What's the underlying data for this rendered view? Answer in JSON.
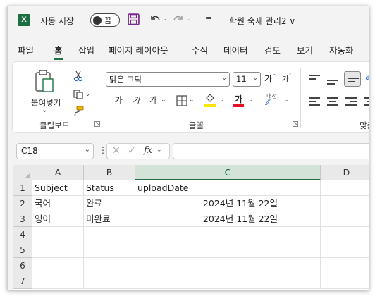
{
  "titlebar": {
    "app_icon": "excel-logo-icon",
    "app_icon_letter": "X",
    "autosave_label": "자동 저장",
    "autosave_state": "끔",
    "doc_title": "학원 숙제 관리2 ∨",
    "customize_glyph": "="
  },
  "tabs": [
    {
      "label": "파일"
    },
    {
      "label": "홈",
      "active": true
    },
    {
      "label": "삽입"
    },
    {
      "label": "페이지 레이아웃"
    },
    {
      "label": "수식"
    },
    {
      "label": "데이터"
    },
    {
      "label": "검토"
    },
    {
      "label": "보기"
    },
    {
      "label": "자동화"
    }
  ],
  "ribbon": {
    "clipboard": {
      "paste_label": "붙여넣기",
      "paste_dropdown": "⌄",
      "group_label": "클립보드"
    },
    "font": {
      "font_name": "맑은 고딕",
      "font_size": "11",
      "grow": "가",
      "shrink": "가",
      "bold": "가",
      "italic": "가",
      "underline": "가",
      "font_color": "가",
      "phonetic": "내천",
      "group_label": "글꼴"
    },
    "alignment": {
      "group_label": "맞춤"
    }
  },
  "formula_bar": {
    "name_box": "C18",
    "fx_label": "fx",
    "value": ""
  },
  "sheet": {
    "columns": [
      "A",
      "B",
      "C",
      "D"
    ],
    "selected_column": "C",
    "rows": [
      "1",
      "2",
      "3",
      "4",
      "5",
      "6",
      "7"
    ],
    "cells": {
      "A1": "Subject",
      "B1": "Status",
      "C1": "uploadDate",
      "A2": "국어",
      "B2": "완료",
      "C2": "2024년 11월 22일",
      "A3": "영어",
      "B3": "미완료",
      "C3": "2024년 11월 22일"
    }
  },
  "colors": {
    "accent": "#1e7145",
    "excel_green": "#1d6f42",
    "save_icon": "#7a2a8c",
    "font_color_bar": "#e81123",
    "fill_color_bar": "#ffe600"
  }
}
